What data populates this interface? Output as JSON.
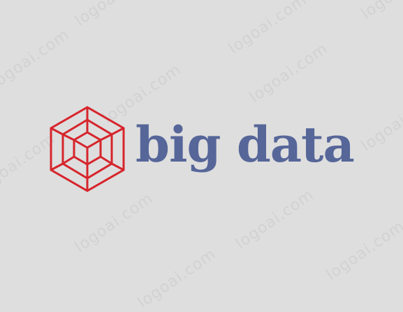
{
  "brand": {
    "name": "big data",
    "text_color": "#566699",
    "mark_color": "#d6252c",
    "mark_icon": "hypercube-icon"
  },
  "watermark": {
    "text": "logoai.com",
    "color": "#d2d2d2"
  },
  "background_color": "#dedede"
}
